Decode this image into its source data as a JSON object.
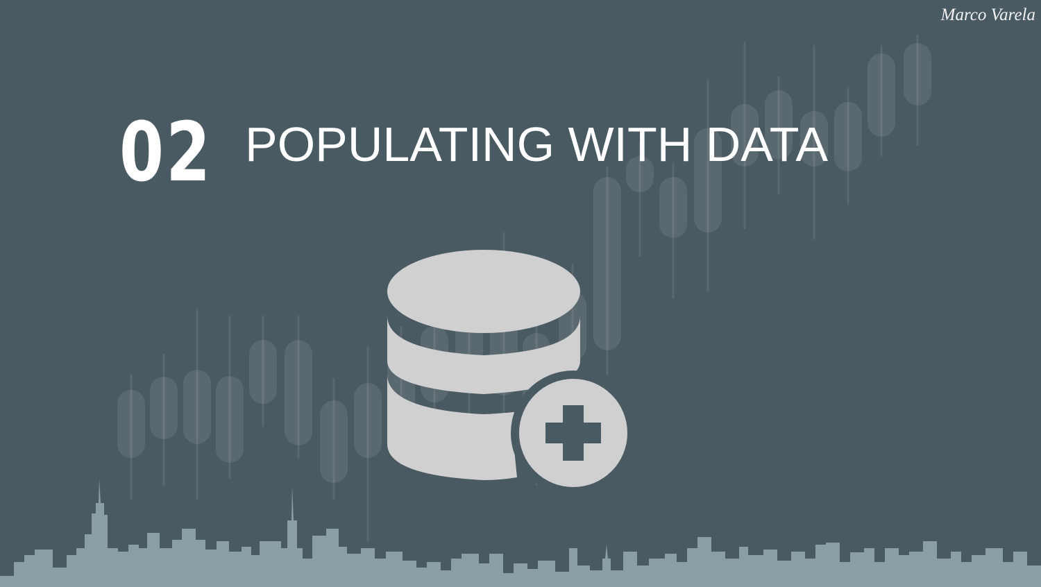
{
  "slide": {
    "number": "02",
    "title": "POPULATING WITH DATA",
    "signature": "Marco Varela"
  },
  "icons": {
    "main": "database-add-icon",
    "background_chart": "candlestick-chart-icon",
    "skyline": "city-skyline-icon"
  },
  "colors": {
    "background": "#4a5a62",
    "text": "#ffffff",
    "icon": "#d0d0d0",
    "skyline": "#8a9ea5"
  }
}
